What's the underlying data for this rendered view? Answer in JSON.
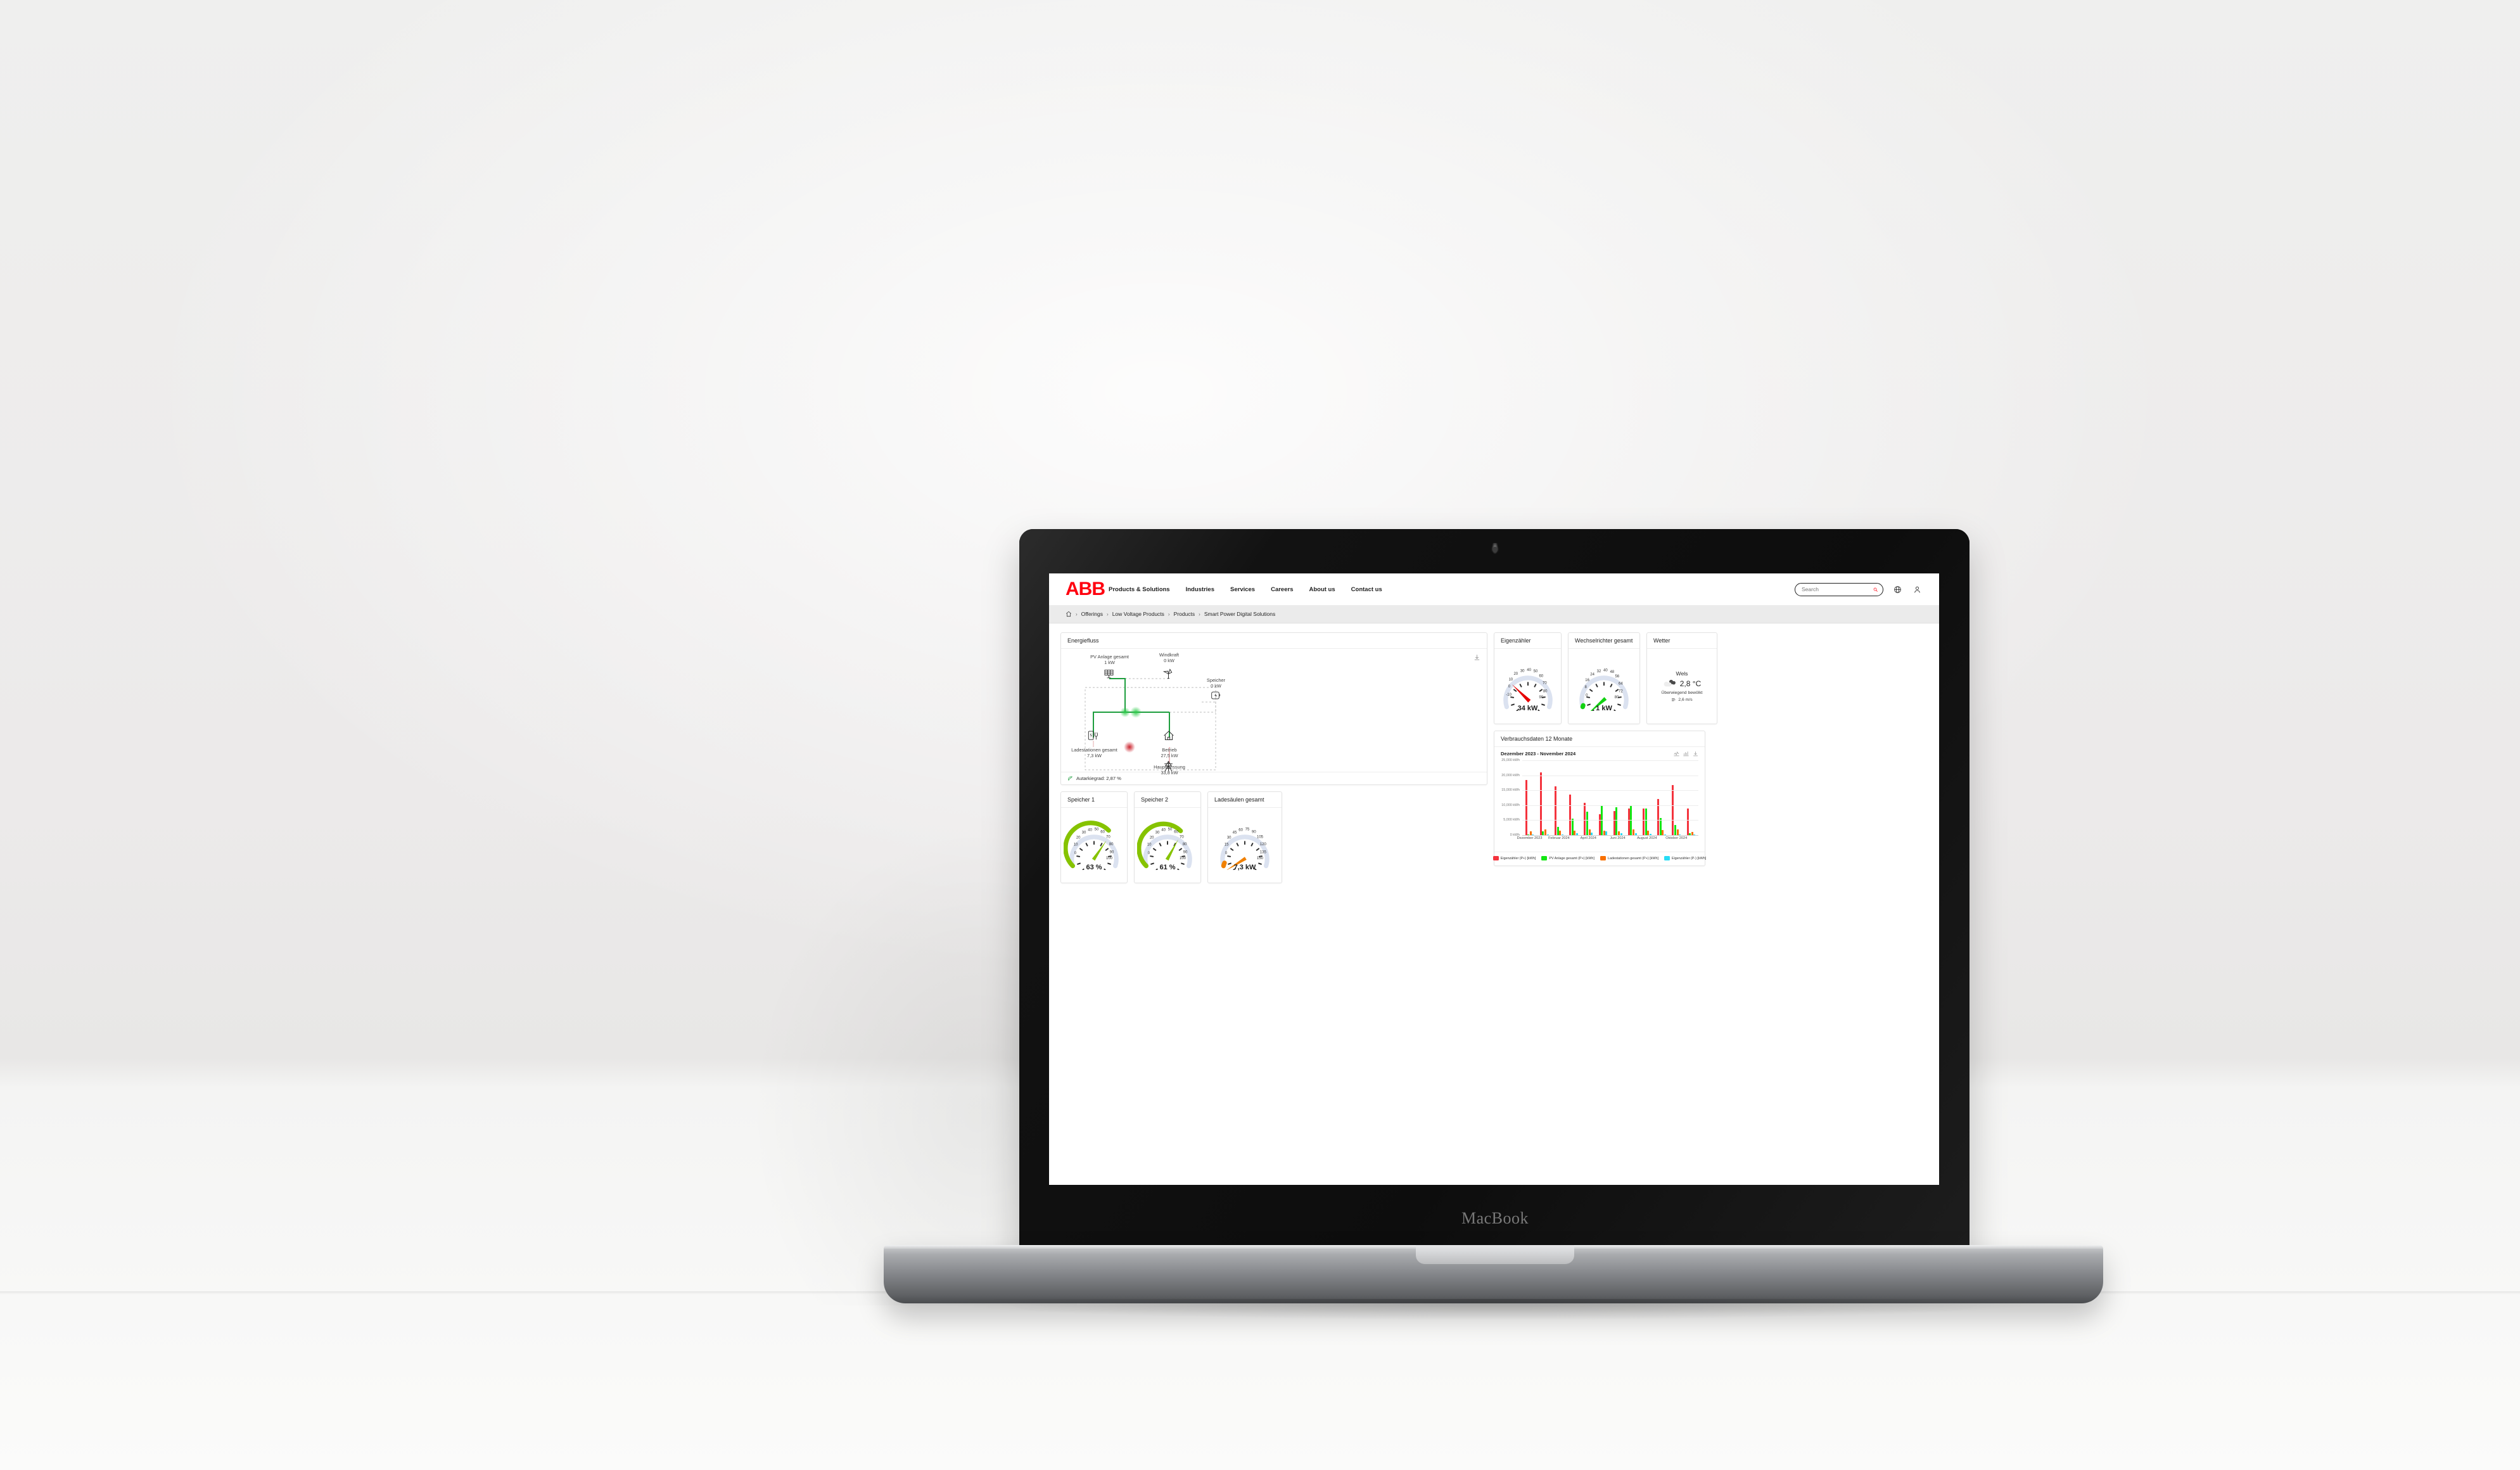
{
  "device": {
    "brand_label": "MacBook"
  },
  "site_header": {
    "logo_text": "ABB",
    "nav": [
      {
        "label": "Products & Solutions"
      },
      {
        "label": "Industries"
      },
      {
        "label": "Services"
      },
      {
        "label": "Careers"
      },
      {
        "label": "About us"
      },
      {
        "label": "Contact us"
      }
    ],
    "search": {
      "placeholder": "Search",
      "value": ""
    },
    "icons": {
      "search": "search-icon",
      "globe": "globe-icon",
      "account": "user-icon"
    }
  },
  "breadcrumb": {
    "home_icon": "home-icon",
    "separator": "›",
    "items": [
      {
        "label": "Offerings"
      },
      {
        "label": "Low Voltage Products"
      },
      {
        "label": "Products"
      },
      {
        "label": "Smart Power Digital Solutions"
      }
    ]
  },
  "energy_flow": {
    "title": "Energiefluss",
    "download_icon": "download-icon",
    "nodes": [
      {
        "id": "pv",
        "label": "PV Anlage gesamt",
        "value": "1 kW",
        "icon": "solar-panel-icon"
      },
      {
        "id": "wind",
        "label": "Windkraft",
        "value": "0 kW",
        "icon": "wind-turbine-icon"
      },
      {
        "id": "storage",
        "label": "Speicher",
        "value": "0 kW",
        "icon": "battery-bolt-icon"
      },
      {
        "id": "charge",
        "label": "Ladestationen gesamt",
        "value": "7,3 kW",
        "icon": "ev-charger-icon"
      },
      {
        "id": "house",
        "label": "Betrieb",
        "value": "27,5 kW",
        "icon": "house-icon"
      },
      {
        "id": "grid",
        "label": "Hauptmessung",
        "value": "33,8 kW",
        "icon": "power-pylon-icon"
      }
    ],
    "footer": {
      "leaf_icon": "leaf-icon",
      "text": "Autarkiegrad: 2,87 %"
    },
    "colors": {
      "green": "#1e9e3e",
      "red": "#b4131a",
      "dashed": "#9a9a9a"
    }
  },
  "gauges": {
    "eigenzaehler": {
      "title": "Eigenzähler",
      "value_text": "34 kW",
      "value": 34,
      "ticks": [
        "-10",
        "0",
        "10",
        "20",
        "30",
        "40",
        "50",
        "60",
        "70",
        "80",
        "90"
      ],
      "min": -10,
      "max": 90,
      "needle_color": "#e60000",
      "arc_color": "#dbe2f0"
    },
    "wechselrichter": {
      "title": "Wechselrichter gesamt",
      "value_text": "1 kW",
      "value": 1,
      "ticks": [
        "0",
        "8",
        "16",
        "24",
        "32",
        "40",
        "48",
        "56",
        "64",
        "72",
        "80"
      ],
      "min": 0,
      "max": 80,
      "needle_color": "#12d112",
      "arc_color": "#dbe2f0"
    },
    "speicher1": {
      "title": "Speicher 1",
      "value_text": "63 %",
      "value": 63,
      "ticks": [
        "0",
        "10",
        "20",
        "30",
        "40",
        "50",
        "60",
        "70",
        "80",
        "90",
        "100"
      ],
      "min": 0,
      "max": 100,
      "needle_color": "#86c300",
      "arc_color": "#dbe2f0",
      "fill_color": "#86c300"
    },
    "speicher2": {
      "title": "Speicher 2",
      "value_text": "61 %",
      "value": 61,
      "ticks": [
        "0",
        "10",
        "20",
        "30",
        "40",
        "50",
        "60",
        "70",
        "80",
        "90",
        "100"
      ],
      "min": 0,
      "max": 100,
      "needle_color": "#86c300",
      "arc_color": "#dbe2f0",
      "fill_color": "#86c300"
    },
    "ladesaeulen": {
      "title": "Ladesäulen gesamt",
      "value_text": "7,3 kW",
      "value": 7.3,
      "ticks": [
        "0",
        "15",
        "30",
        "45",
        "60",
        "75",
        "90",
        "105",
        "120",
        "135",
        "150"
      ],
      "min": 0,
      "max": 150,
      "needle_color": "#f08000",
      "arc_color": "#dbe2f0"
    }
  },
  "weather": {
    "title": "Wetter",
    "city": "Wels",
    "temperature": "2,8 °C",
    "description": "Überwiegend bewölkt",
    "wind": "2,6 m/s",
    "wind_icon": "wind-icon",
    "condition_icon": "cloudy-icon"
  },
  "consumption_card": {
    "title": "Verbrauchsdaten 12 Monate",
    "range": "Dezember 2023 - November 2024",
    "tools": [
      {
        "name": "line-chart-icon"
      },
      {
        "name": "bar-chart-icon"
      },
      {
        "name": "download-icon"
      }
    ]
  },
  "chart_data": {
    "type": "bar",
    "title": "Verbrauchsdaten 12 Monate",
    "subtitle": "Dezember 2023 - November 2024",
    "xlabel": "",
    "ylabel": "kWh",
    "ylim": [
      0,
      25000
    ],
    "yticks": [
      0,
      5000,
      10000,
      15000,
      20000,
      25000
    ],
    "ytick_labels": [
      "0 kWh",
      "5,000 kWh",
      "10,000 kWh",
      "15,000 kWh",
      "20,000 kWh",
      "25,000 kWh"
    ],
    "grid": true,
    "legend_position": "bottom",
    "categories": [
      "Dezember 2023",
      "Januar 2024",
      "Februar 2024",
      "März 2024",
      "April 2024",
      "Mai 2024",
      "Juni 2024",
      "Juli 2024",
      "August 2024",
      "September 2024",
      "Oktober 2024",
      "November 2024"
    ],
    "xtick_labels": [
      "Dezember 2023",
      "Februar 2024",
      "April 2024",
      "Juni 2024",
      "August 2024",
      "Oktober 2024"
    ],
    "series": [
      {
        "name": "Eigenzähler (P+) [kWh]",
        "color": "#f4333d",
        "values": [
          18500,
          21000,
          16300,
          13600,
          10900,
          7100,
          8000,
          9000,
          8900,
          12000,
          16800,
          8800
        ]
      },
      {
        "name": "PV Anlage gesamt (P+) [kWh]",
        "color": "#13e613",
        "values": [
          0,
          1350,
          2850,
          5500,
          7850,
          9950,
          9400,
          9800,
          9000,
          5750,
          3300,
          600
        ]
      },
      {
        "name": "Ladestationen gesamt (P+) [kWh]",
        "color": "#f87000",
        "values": [
          1300,
          1900,
          1450,
          1500,
          1850,
          1400,
          1300,
          1950,
          1500,
          1800,
          1850,
          1050
        ]
      },
      {
        "name": "Eigenzähler (P-) [kWh]",
        "color": "#27dcf5",
        "values": [
          150,
          120,
          250,
          550,
          950,
          1250,
          700,
          550,
          380,
          200,
          130,
          60
        ]
      }
    ]
  }
}
